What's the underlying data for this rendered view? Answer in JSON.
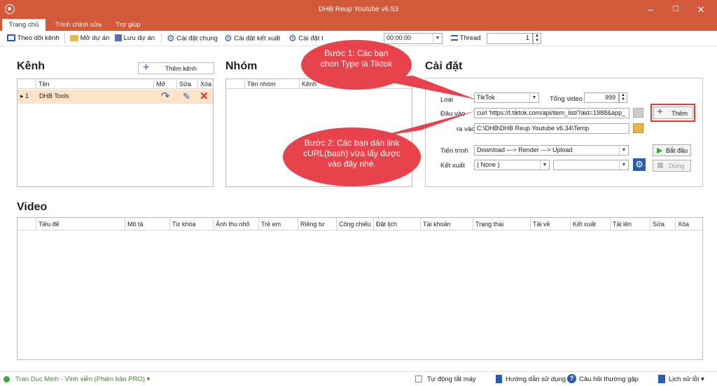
{
  "window": {
    "title": "DHB Reup Youtube v6.53"
  },
  "tabs": [
    "Trang chủ",
    "Trình chỉnh sửa",
    "Trợ giúp"
  ],
  "toolbar": {
    "theo_doi_kenh": "Theo dõi kênh",
    "mo_du_an": "Mở dự án",
    "luu_du_an": "Lưu dự án",
    "cai_dat_chung": "Cài đặt chung",
    "cai_dat_ket_xuat": "Cài đặt kết xuất",
    "cai_dat_cut": "Cài đặt t",
    "time_value": "00:00:00",
    "thread_label": "Thread",
    "thread_value": "1"
  },
  "kenh": {
    "heading": "Kênh",
    "add_button": "Thêm kênh",
    "columns": [
      "Tên",
      "Mở",
      "Sửa",
      "Xóa"
    ],
    "rows": [
      {
        "index": "1",
        "name": "DHB Tools"
      }
    ]
  },
  "nhom": {
    "heading": "Nhóm",
    "columns": [
      "Tên nhóm",
      "Kênh"
    ]
  },
  "caidat": {
    "heading": "Cài đặt",
    "loai_label": "Loại",
    "loai_value": "TikTok",
    "tong_video_label": "Tổng video",
    "tong_video_value": "999",
    "dau_vao_label": "Đầu vào",
    "dau_vao_value": "curl 'https://t.tiktok.com/api/item_list/?aid=1988&app_",
    "dau_ra_label": "ra vào",
    "dau_ra_value": "C:\\DHB\\DHB Reup Youtube v6.34\\Temp",
    "them_button": "Thêm",
    "tien_trinh_label": "Tiến trình",
    "tien_trinh_value": "Download ---> Render ---> Upload",
    "bat_dau_button": "Bắt đầu",
    "ket_xuat_label": "Kết xuất",
    "ket_xuat_value": "( None )",
    "dung_button": "Dừng"
  },
  "callouts": {
    "step1": "Bước 1: Các bạn chon Type là Tiktok",
    "step2": "Bước 2: Các bạn dán link cURL(bash) vừa lấy được vào đây nhé."
  },
  "video": {
    "heading": "Video",
    "columns": [
      "Tiêu đề",
      "Mô tả",
      "Từ khóa",
      "Ảnh thu nhỏ",
      "Trẻ em",
      "Riêng tư",
      "Công chiếu",
      "Đặt lịch",
      "Tài khoản",
      "Trạng thái",
      "Tải về",
      "Kết xuất",
      "Tải lên",
      "Sửa",
      "Xóa"
    ]
  },
  "status": {
    "user": "Tran Duc Minh - Vĩnh viễn (Phiên bản PRO)",
    "auto_shutdown": "Tự động tắt máy",
    "guide": "Hướng dẫn sử dụng",
    "faq": "Câu hỏi thường gặp",
    "history": "Lịch sử lỗi"
  },
  "colors": {
    "accent": "#d25a3a",
    "callout": "#e8424c",
    "row_highlight": "#fde3c8"
  }
}
